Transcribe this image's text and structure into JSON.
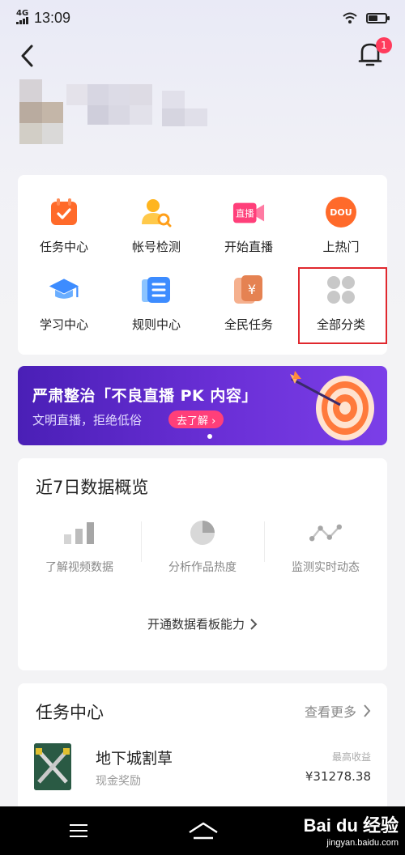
{
  "status_bar": {
    "network": "4G",
    "time": "13:09",
    "battery_level": 0.55
  },
  "header": {
    "notification_count": "1"
  },
  "tools": [
    {
      "label": "任务中心",
      "icon": "calendar-check-icon"
    },
    {
      "label": "帐号检测",
      "icon": "account-search-icon"
    },
    {
      "label": "开始直播",
      "icon": "live-camera-icon"
    },
    {
      "label": "上热门",
      "icon": "dou-plus-icon",
      "icon_text": "DOU"
    },
    {
      "label": "学习中心",
      "icon": "graduation-cap-icon"
    },
    {
      "label": "规则中心",
      "icon": "rules-book-icon"
    },
    {
      "label": "全民任务",
      "icon": "yuan-card-icon",
      "icon_text": "¥"
    },
    {
      "label": "全部分类",
      "icon": "all-categories-icon"
    }
  ],
  "banner": {
    "title": "严肃整治「不良直播 PK 内容」",
    "subtitle": "文明直播，拒绝低俗",
    "cta": "去了解 ›"
  },
  "data_overview": {
    "title": "近7日数据概览",
    "items": [
      {
        "label": "了解视频数据",
        "icon": "bar-chart-icon"
      },
      {
        "label": "分析作品热度",
        "icon": "pie-chart-icon"
      },
      {
        "label": "监测实时动态",
        "icon": "line-trend-icon"
      }
    ],
    "open_link": "开通数据看板能力"
  },
  "task_center": {
    "title": "任务中心",
    "view_more": "查看更多",
    "tasks": [
      {
        "name": "地下城割草",
        "reward_type": "现金奖励",
        "earn_label": "最高收益",
        "earn_value": "¥31278.38"
      }
    ]
  },
  "watermark": {
    "brand": "Bai du 经验",
    "url": "jingyan.baidu.com"
  },
  "colors": {
    "accent": "#ff6a2a",
    "highlight": "#e0282e",
    "banner": "#5a27c8",
    "cta": "#ff3f7a"
  }
}
